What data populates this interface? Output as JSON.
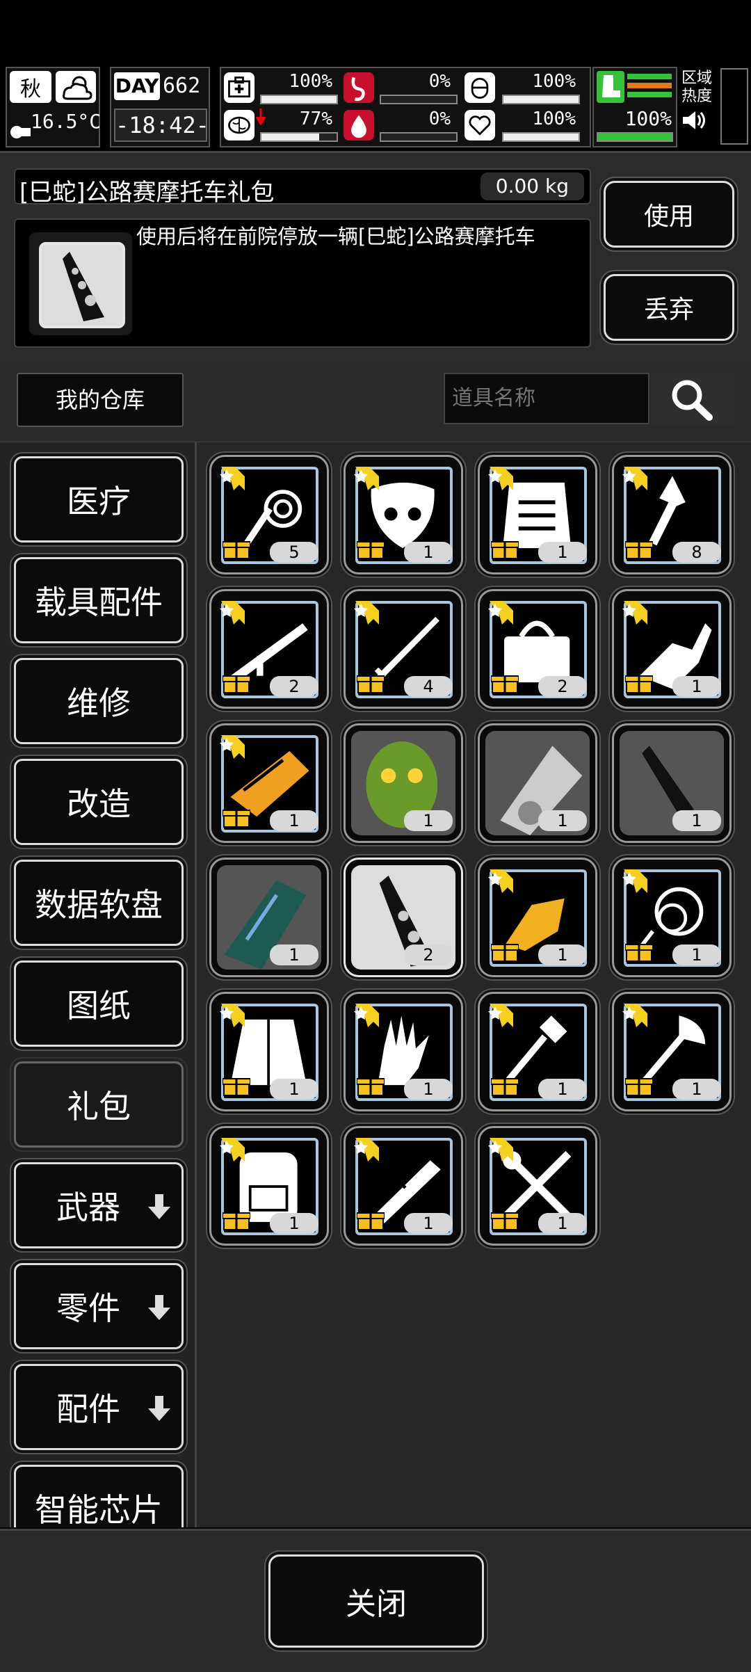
{
  "hud": {
    "season": "秋",
    "temperature": "16.5°C",
    "day_label": "DAY",
    "day_number": "662",
    "clock": "-18:42-",
    "stats": [
      {
        "id": "health",
        "value": "100%",
        "level": 1.0
      },
      {
        "id": "hunger",
        "value": "0%",
        "level": 0.0
      },
      {
        "id": "armor",
        "value": "100%",
        "level": 1.0
      },
      {
        "id": "mind",
        "value": "77%",
        "level": 0.77
      },
      {
        "id": "blood",
        "value": "0%",
        "level": 0.0
      },
      {
        "id": "heart",
        "value": "100%",
        "level": 1.0
      }
    ],
    "stamina_value": "100%",
    "stamina_level": 1.0,
    "region_label": "区域\n热度",
    "colors": {
      "accent_green": "#35c23a",
      "alert_red": "#c8102e",
      "bar_orange": "#e07a1f"
    }
  },
  "detail": {
    "item_name": "[巳蛇]公路赛摩托车礼包",
    "weight": "0.00 kg",
    "description": "使用后将在前院停放一辆[巳蛇]公路赛摩托车",
    "use_label": "使用",
    "discard_label": "丢弃"
  },
  "warehouse": {
    "tab_label": "我的仓库",
    "search_placeholder": "道具名称"
  },
  "categories": [
    {
      "label": "医疗",
      "arrow": false,
      "selected": false
    },
    {
      "label": "载具配件",
      "arrow": false,
      "selected": false
    },
    {
      "label": "维修",
      "arrow": false,
      "selected": false
    },
    {
      "label": "改造",
      "arrow": false,
      "selected": false
    },
    {
      "label": "数据软盘",
      "arrow": false,
      "selected": false
    },
    {
      "label": "图纸",
      "arrow": false,
      "selected": false
    },
    {
      "label": "礼包",
      "arrow": false,
      "selected": true
    },
    {
      "label": "武器",
      "arrow": true,
      "selected": false
    },
    {
      "label": "零件",
      "arrow": true,
      "selected": false
    },
    {
      "label": "配件",
      "arrow": true,
      "selected": false
    },
    {
      "label": "智能芯片",
      "arrow": false,
      "selected": false
    }
  ],
  "items": [
    {
      "icon": "whip-icon",
      "qty": "5",
      "style": "gift"
    },
    {
      "icon": "mask-icon",
      "qty": "1",
      "style": "gift"
    },
    {
      "icon": "vest-icon",
      "qty": "1",
      "style": "gift"
    },
    {
      "icon": "rocket-icon",
      "qty": "8",
      "style": "gift"
    },
    {
      "icon": "rifle-icon",
      "qty": "2",
      "style": "gift"
    },
    {
      "icon": "sword-icon",
      "qty": "4",
      "style": "gift"
    },
    {
      "icon": "bag-icon",
      "qty": "2",
      "style": "gift"
    },
    {
      "icon": "gauntlet-icon",
      "qty": "1",
      "style": "gift"
    },
    {
      "icon": "orange-armor-icon",
      "qty": "1",
      "style": "gift-orange"
    },
    {
      "icon": "snake-head-icon",
      "qty": "1",
      "style": "dark"
    },
    {
      "icon": "car-icon",
      "qty": "1",
      "style": "dark"
    },
    {
      "icon": "motorcycle-icon",
      "qty": "1",
      "style": "dark"
    },
    {
      "icon": "dragon-mech-icon",
      "qty": "1",
      "style": "dark"
    },
    {
      "icon": "motorcycle-pack-icon",
      "qty": "2",
      "style": "dark-selected"
    },
    {
      "icon": "gold-mech-icon",
      "qty": "1",
      "style": "gift"
    },
    {
      "icon": "rope-icon",
      "qty": "1",
      "style": "gift"
    },
    {
      "icon": "jacket-icon",
      "qty": "1",
      "style": "gift"
    },
    {
      "icon": "glove-icon",
      "qty": "1",
      "style": "gift"
    },
    {
      "icon": "shovel-icon",
      "qty": "1",
      "style": "gift"
    },
    {
      "icon": "axe-icon",
      "qty": "1",
      "style": "gift"
    },
    {
      "icon": "backpack-icon",
      "qty": "1",
      "style": "gift"
    },
    {
      "icon": "bone-saw-icon",
      "qty": "1",
      "style": "gift"
    },
    {
      "icon": "tools-icon",
      "qty": "1",
      "style": "gift"
    }
  ],
  "footer": {
    "close_label": "关闭"
  }
}
